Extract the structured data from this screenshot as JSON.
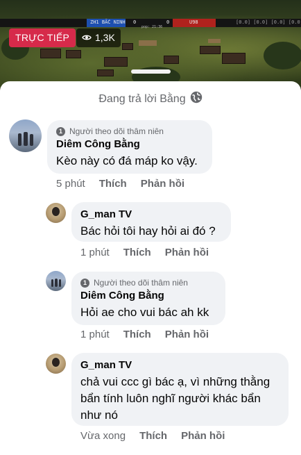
{
  "video": {
    "live_label": "TRỰC TIẾP",
    "viewer_count": "1,3K",
    "hud_team_a": "ZH1 BẮC NINH",
    "hud_score_a": "0",
    "hud_score_b": "0",
    "hud_team_b": "U98",
    "hud_right": "[0.0] [0.0] [0.0] [0.0] [0.0] [0.0]",
    "hud_sub": "pop: 21:36"
  },
  "reply_context": "Đang trả lời Bằng",
  "comments": [
    {
      "badge": "Người theo dõi thâm niên",
      "author": "Diêm Công Bằng",
      "text": "Kèo này có đá máp ko vậy.",
      "time": "5 phút",
      "like": "Thích",
      "reply": "Phản hồi"
    },
    {
      "author": "G_man TV",
      "text": "Bác hỏi tôi hay hỏi ai đó ?",
      "time": "1 phút",
      "like": "Thích",
      "reply": "Phản hồi"
    },
    {
      "badge": "Người theo dõi thâm niên",
      "author": "Diêm Công Bằng",
      "text": "Hỏi ae cho vui bác ah kk",
      "time": "1 phút",
      "like": "Thích",
      "reply": "Phản hồi"
    },
    {
      "author": "G_man TV",
      "text_lines": [
        "chả vui ccc gì bác ạ, vì những thằng",
        "bẩn tính luôn nghĩ người khác bẩn",
        "như nó"
      ],
      "time": "Vừa xong",
      "like": "Thích",
      "reply": "Phản hồi"
    }
  ],
  "colors": {
    "live_red": "#d62a4a",
    "bubble_bg": "#f0f2f5",
    "secondary_text": "#65676b"
  },
  "icons": [
    "eye-icon",
    "globe-icon",
    "badge-icon"
  ]
}
